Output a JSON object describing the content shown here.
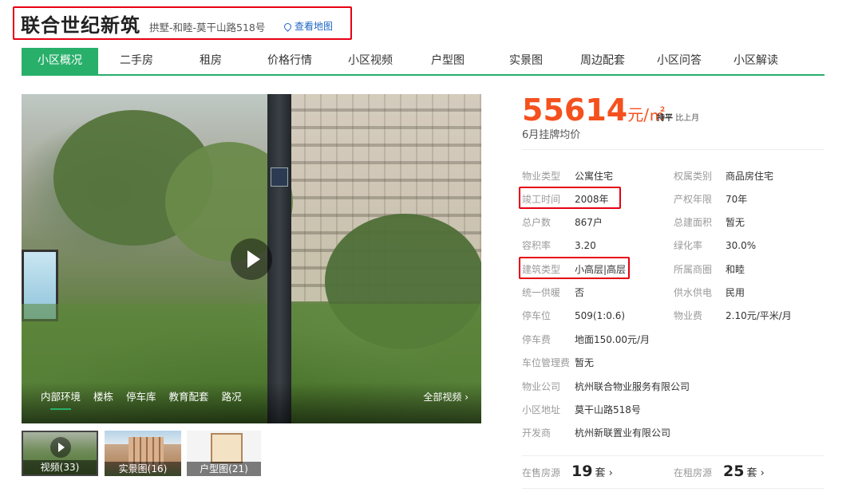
{
  "header": {
    "title": "联合世纪新筑",
    "address": "拱墅-和睦-莫干山路518号",
    "map_link": "查看地图"
  },
  "nav": {
    "tabs": [
      {
        "label": "小区概况",
        "active": true
      },
      {
        "label": "二手房"
      },
      {
        "label": "租房"
      },
      {
        "label": "价格行情"
      },
      {
        "label": "小区视频"
      },
      {
        "label": "户型图"
      },
      {
        "label": "实景图"
      },
      {
        "label": "周边配套"
      },
      {
        "label": "小区问答"
      },
      {
        "label": "小区解读"
      }
    ]
  },
  "media": {
    "photo_tabs": [
      "内部环境",
      "楼栋",
      "停车库",
      "教育配套",
      "路况"
    ],
    "all_videos": "全部视频 ›",
    "thumbnails": [
      {
        "label": "视频(33)"
      },
      {
        "label": "实景图(16)"
      },
      {
        "label": "户型图(21)"
      }
    ]
  },
  "price": {
    "value": "55614",
    "unit": "元/㎡",
    "trend_strong": "持平",
    "trend_text": "比上月",
    "note": "6月挂牌均价"
  },
  "details": {
    "left": [
      {
        "label": "物业类型",
        "value": "公寓住宅"
      },
      {
        "label": "竣工时间",
        "value": "2008年"
      },
      {
        "label": "总户数",
        "value": "867户"
      },
      {
        "label": "容积率",
        "value": "3.20"
      },
      {
        "label": "建筑类型",
        "value": "小高层|高层"
      },
      {
        "label": "统一供暖",
        "value": "否"
      },
      {
        "label": "停车位",
        "value": "509(1:0.6)"
      },
      {
        "label": "停车费",
        "value": "地面150.00元/月"
      },
      {
        "label": "车位管理费",
        "value": "暂无"
      },
      {
        "label": "物业公司",
        "value": "杭州联合物业服务有限公司"
      },
      {
        "label": "小区地址",
        "value": "莫干山路518号"
      },
      {
        "label": "开发商",
        "value": "杭州新联置业有限公司"
      }
    ],
    "right": [
      {
        "label": "权属类别",
        "value": "商品房住宅"
      },
      {
        "label": "产权年限",
        "value": "70年"
      },
      {
        "label": "总建面积",
        "value": "暂无"
      },
      {
        "label": "绿化率",
        "value": "30.0%"
      },
      {
        "label": "所属商圈",
        "value": "和睦"
      },
      {
        "label": "供水供电",
        "value": "民用"
      },
      {
        "label": "物业费",
        "value": "2.10元/平米/月"
      }
    ]
  },
  "listings": {
    "sale": {
      "label": "在售房源",
      "count": "19",
      "unit": "套 ›"
    },
    "rent": {
      "label": "在租房源",
      "count": "25",
      "unit": "套 ›"
    }
  },
  "colors": {
    "accent_green": "#28b06b",
    "price_orange": "#f4511e",
    "highlight_red": "#e60012",
    "link_blue": "#1d66c6"
  }
}
